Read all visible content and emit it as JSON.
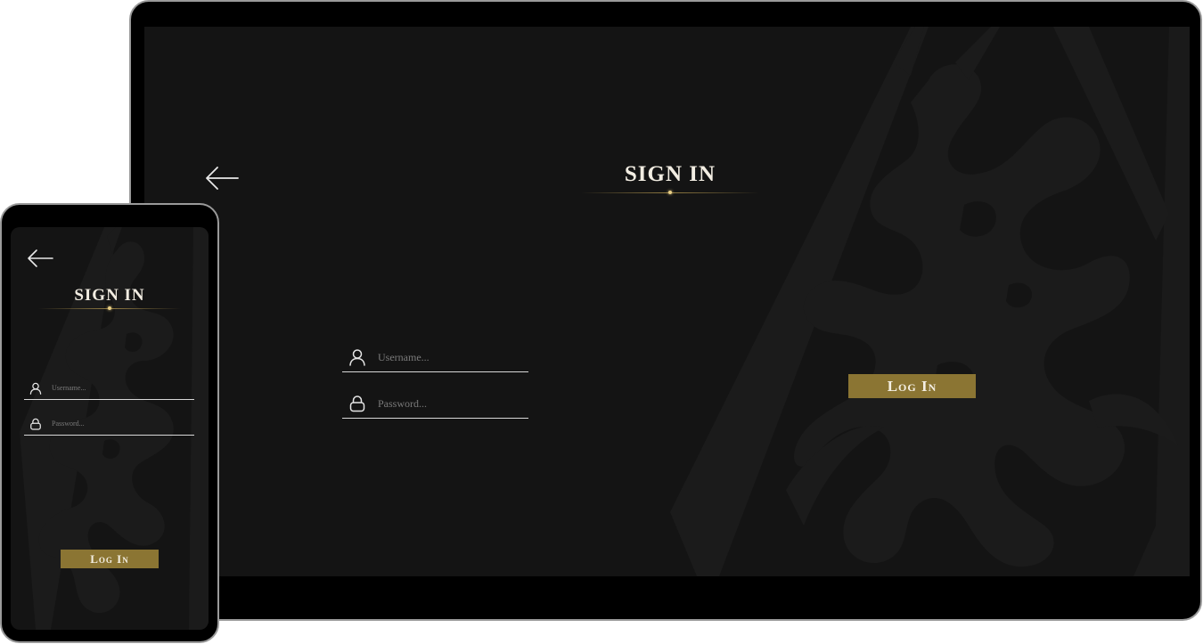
{
  "tablet": {
    "title": "SIGN IN",
    "username_placeholder": "Username...",
    "password_placeholder": "Password...",
    "login_label": "Log In"
  },
  "phone": {
    "title": "SIGN IN",
    "username_placeholder": "Username...",
    "password_placeholder": "Password...",
    "login_label": "Log In"
  },
  "colors": {
    "device_frame": "#000000",
    "device_border": "#9a9a9a",
    "screen_bg": "#141414",
    "emblem": "#1d1d1d",
    "accent_gold": "#8b7533",
    "divider_gold": "#a88e4a",
    "text_light": "#f2ede2"
  },
  "icons": {
    "back": "arrow-left-icon",
    "user": "user-icon",
    "lock": "lock-icon",
    "emblem": "dragon-emblem"
  }
}
